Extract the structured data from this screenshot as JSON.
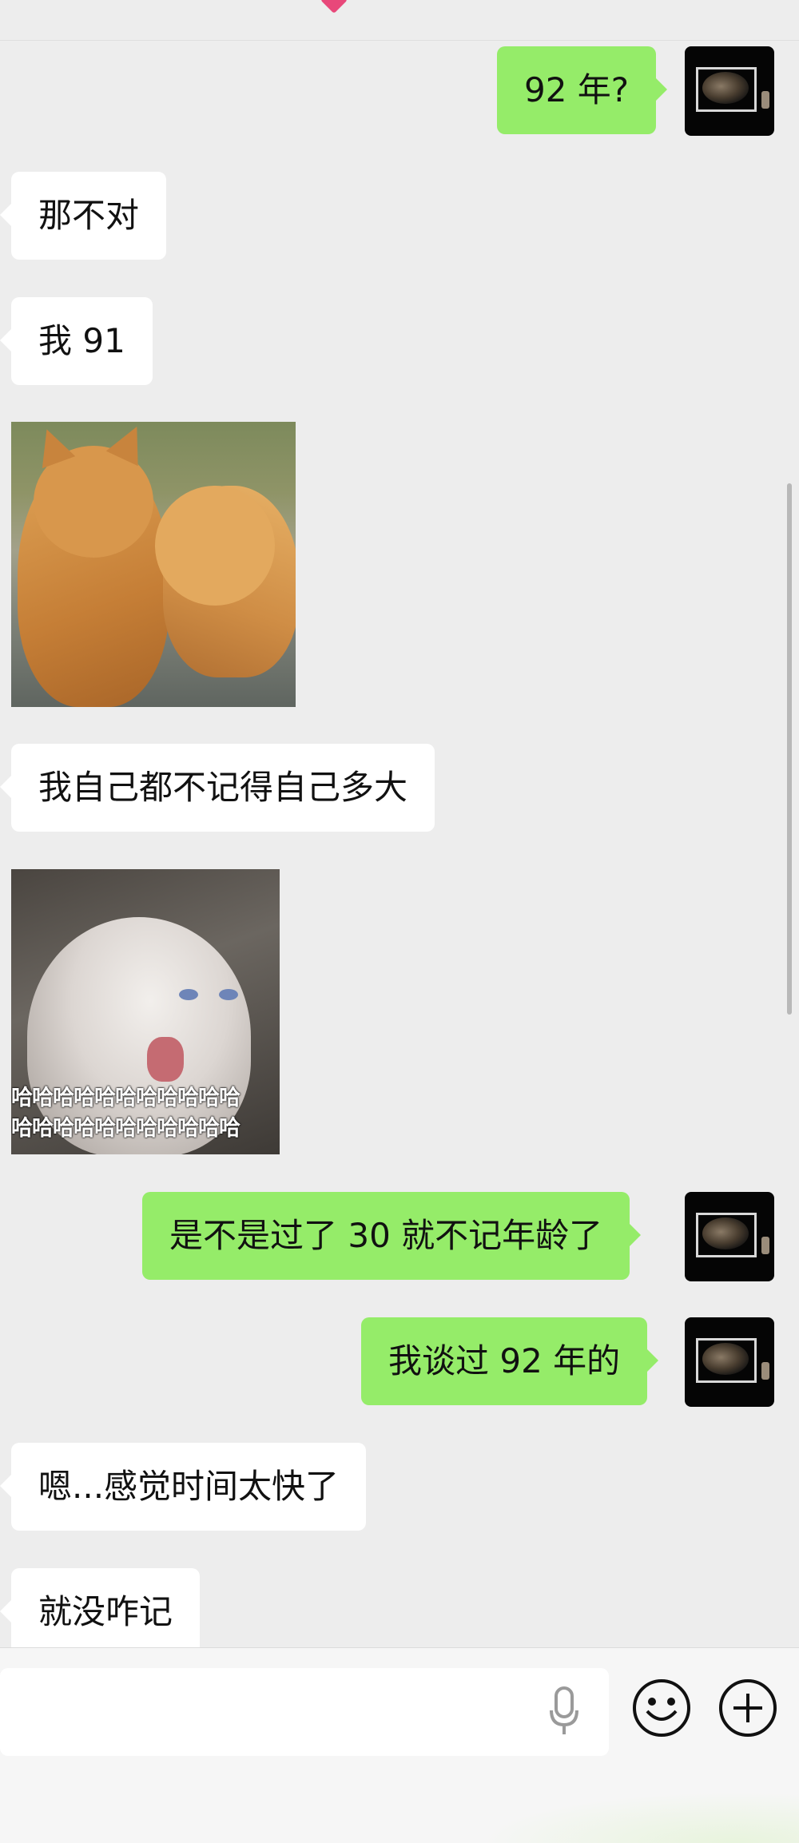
{
  "messages": [
    {
      "id": "m1",
      "side": "out",
      "text": "92 年?"
    },
    {
      "id": "m2",
      "side": "in",
      "text": "那不对"
    },
    {
      "id": "m3",
      "side": "in",
      "text": "我 91"
    },
    {
      "id": "m4",
      "side": "in",
      "type": "sticker",
      "sticker": "two-orange-cats"
    },
    {
      "id": "m5",
      "side": "in",
      "text": "我自己都不记得自己多大"
    },
    {
      "id": "m6",
      "side": "in",
      "type": "sticker",
      "sticker": "screaming-white-cat",
      "caption_lines": [
        "哈哈哈哈哈哈哈哈哈哈哈",
        "哈哈哈哈哈哈哈哈哈哈哈"
      ]
    },
    {
      "id": "m7",
      "side": "out",
      "text": "是不是过了 30 就不记年龄了"
    },
    {
      "id": "m8",
      "side": "out",
      "text": "我谈过 92 年的"
    },
    {
      "id": "m9",
      "side": "in",
      "text": "嗯...感觉时间太快了"
    },
    {
      "id": "m10",
      "side": "in",
      "text": "就没咋记"
    }
  ],
  "input_bar": {
    "text_value": "",
    "icons": [
      "microphone-icon",
      "emoji-icon",
      "plus-icon"
    ]
  },
  "colors": {
    "background": "#ededed",
    "outgoing_bubble": "#95ec69",
    "incoming_bubble": "#ffffff",
    "input_bar": "#f6f6f6"
  }
}
